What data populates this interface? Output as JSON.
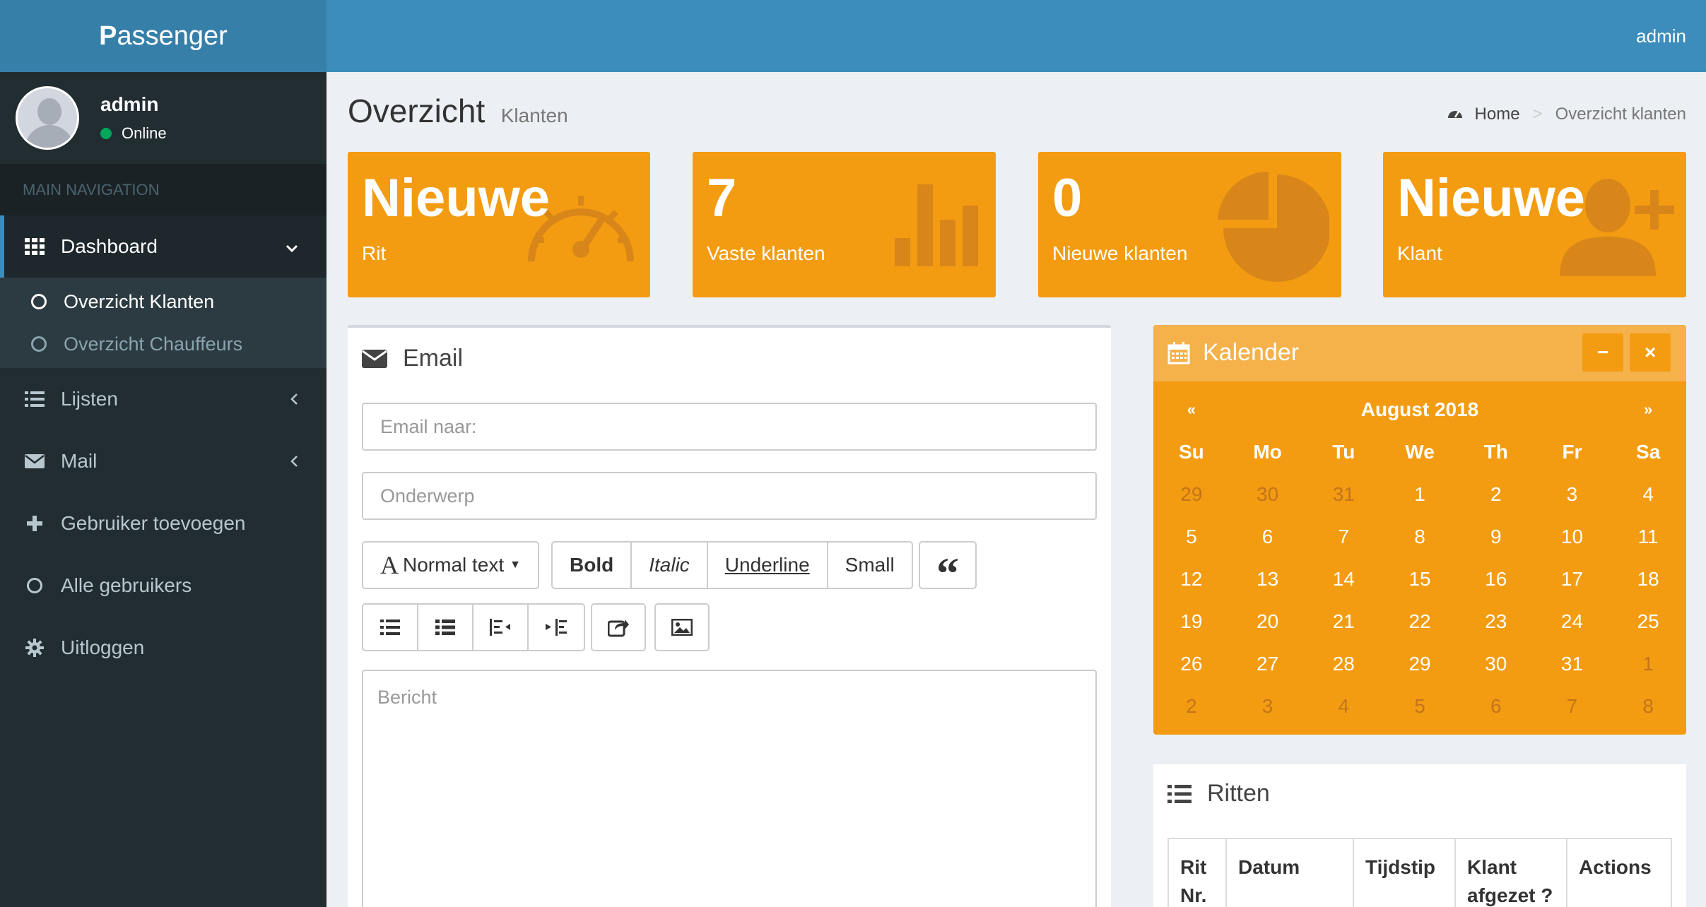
{
  "app": {
    "logo_bold": "P",
    "logo_rest": "assenger",
    "top_user": "admin"
  },
  "sidebar": {
    "user": {
      "name": "admin",
      "status": "Online"
    },
    "header": "MAIN NAVIGATION",
    "dashboard": {
      "label": "Dashboard",
      "icon": "grid-icon"
    },
    "submenu": [
      {
        "label": "Overzicht Klanten"
      },
      {
        "label": "Overzicht Chauffeurs"
      }
    ],
    "items": [
      {
        "label": "Lijsten",
        "icon": "list-icon"
      },
      {
        "label": "Mail",
        "icon": "envelope-icon"
      },
      {
        "label": "Gebruiker toevoegen",
        "icon": "plus-icon"
      },
      {
        "label": "Alle gebruikers",
        "icon": "circle-icon"
      },
      {
        "label": "Uitloggen",
        "icon": "gear-icon"
      }
    ]
  },
  "content": {
    "title": "Overzicht",
    "subtitle": "Klanten",
    "breadcrumb": {
      "home": "Home",
      "current": "Overzicht klanten"
    }
  },
  "tiles": [
    {
      "big": "Nieuwe",
      "small": "Rit",
      "icon": "dashboard-icon"
    },
    {
      "big": "7",
      "small": "Vaste klanten",
      "icon": "bar-chart-icon"
    },
    {
      "big": "0",
      "small": "Nieuwe klanten",
      "icon": "pie-chart-icon"
    },
    {
      "big": "Nieuwe",
      "small": "Klant",
      "icon": "user-plus-icon"
    }
  ],
  "email": {
    "title": "Email",
    "to_placeholder": "Email naar:",
    "subject_placeholder": "Onderwerp",
    "format": {
      "normal": "Normal text",
      "bold": "Bold",
      "italic": "Italic",
      "underline": "Underline",
      "small": "Small",
      "quote": "“"
    },
    "body_placeholder": "Bericht"
  },
  "calendar": {
    "title": "Kalender",
    "month": "August 2018",
    "prev": "«",
    "next": "»",
    "minimize": "−",
    "close": "×",
    "days": [
      "Su",
      "Mo",
      "Tu",
      "We",
      "Th",
      "Fr",
      "Sa"
    ],
    "weeks": [
      [
        "29",
        "30",
        "31",
        "1",
        "2",
        "3",
        "4"
      ],
      [
        "5",
        "6",
        "7",
        "8",
        "9",
        "10",
        "11"
      ],
      [
        "12",
        "13",
        "14",
        "15",
        "16",
        "17",
        "18"
      ],
      [
        "19",
        "20",
        "21",
        "22",
        "23",
        "24",
        "25"
      ],
      [
        "26",
        "27",
        "28",
        "29",
        "30",
        "31",
        "1"
      ],
      [
        "2",
        "3",
        "4",
        "5",
        "6",
        "7",
        "8"
      ]
    ]
  },
  "ritten": {
    "title": "Ritten",
    "columns": [
      {
        "line1": "Rit",
        "line2": "Nr."
      },
      {
        "line1": "Datum",
        "line2": ""
      },
      {
        "line1": "Tijdstip",
        "line2": ""
      },
      {
        "line1": "Klant",
        "line2": "afgezet ?"
      },
      {
        "line1": "Actions",
        "line2": ""
      }
    ]
  },
  "colors": {
    "sidebar": "#222d32",
    "header": "#3c8dbc",
    "tile": "#f39c12",
    "accent": "#00a65a"
  }
}
